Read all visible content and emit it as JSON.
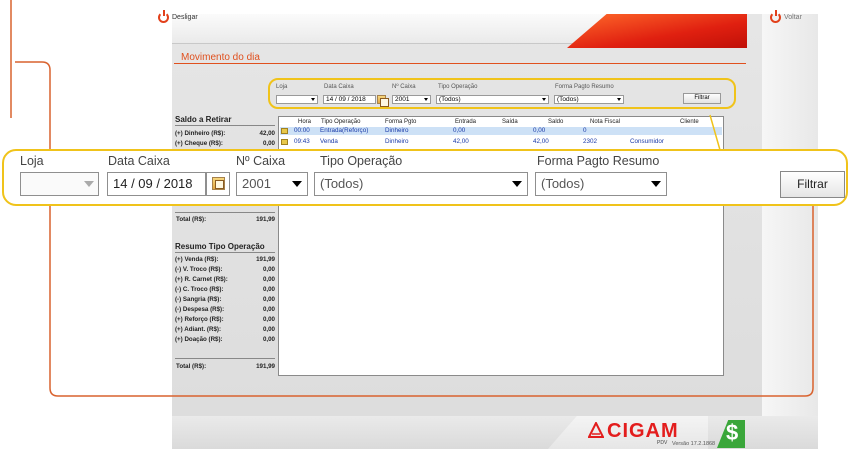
{
  "header": {
    "desligar_label": "Desligar",
    "voltar_label": "Voltar"
  },
  "page_title": "Movimento do dia",
  "filters": {
    "loja_label": "Loja",
    "loja_value": "",
    "data_caixa_label": "Data Caixa",
    "data_caixa_value": "14 / 09 / 2018",
    "num_caixa_label": "Nº Caixa",
    "num_caixa_value": "2001",
    "tipo_operacao_label": "Tipo Operação",
    "tipo_operacao_value": "(Todos)",
    "forma_pagto_label": "Forma Pagto Resumo",
    "forma_pagto_value": "(Todos)",
    "filtrar_label": "Filtrar"
  },
  "saldo_retirar": {
    "title": "Saldo a Retirar",
    "rows": [
      {
        "label": "(+) Dinheiro (R$):",
        "value": "42,00"
      },
      {
        "label": "(+) Cheque (R$):",
        "value": "0,00"
      }
    ],
    "total_label": "Total (R$):",
    "total_value": "191,99"
  },
  "resumo_tipo": {
    "title": "Resumo Tipo Operação",
    "rows": [
      {
        "label": "(+) Venda (R$):",
        "value": "191,99"
      },
      {
        "label": "(-) V. Troco (R$):",
        "value": "0,00"
      },
      {
        "label": "(+) R. Carnet (R$):",
        "value": "0,00"
      },
      {
        "label": "(-) C. Troco (R$):",
        "value": "0,00"
      },
      {
        "label": "(-) Sangria (R$):",
        "value": "0,00"
      },
      {
        "label": "(-) Despesa (R$):",
        "value": "0,00"
      },
      {
        "label": "(+) Reforço (R$):",
        "value": "0,00"
      },
      {
        "label": "(+) Adiant. (R$):",
        "value": "0,00"
      },
      {
        "label": "(+) Doação (R$):",
        "value": "0,00"
      }
    ],
    "total_label": "Total (R$):",
    "total_value": "191,99"
  },
  "grid": {
    "columns": [
      "Hora",
      "Tipo Operação",
      "Forma Pgto",
      "Entrada",
      "Saída",
      "Saldo",
      "Nota Fiscal",
      "Cliente"
    ],
    "rows": [
      {
        "hora": "00:00",
        "tipo": "Entrada(Reforço)",
        "forma": "Dinheiro",
        "entrada": "0,00",
        "saida": "",
        "saldo": "0,00",
        "nota": "0",
        "cliente": ""
      },
      {
        "hora": "09:43",
        "tipo": "Venda",
        "forma": "Dinheiro",
        "entrada": "42,00",
        "saida": "",
        "saldo": "42,00",
        "nota": "2302",
        "cliente": "Consumidor"
      }
    ]
  },
  "footer": {
    "logo_text": "CIGAM",
    "pdv": "PDV",
    "versao": "Versão 17.2.1868",
    "dollar": "$"
  },
  "colors": {
    "accent_orange": "#e0501e",
    "highlight_yellow": "#f0c31a",
    "brand_red": "#e31d1d",
    "brand_green": "#3aa63a"
  }
}
